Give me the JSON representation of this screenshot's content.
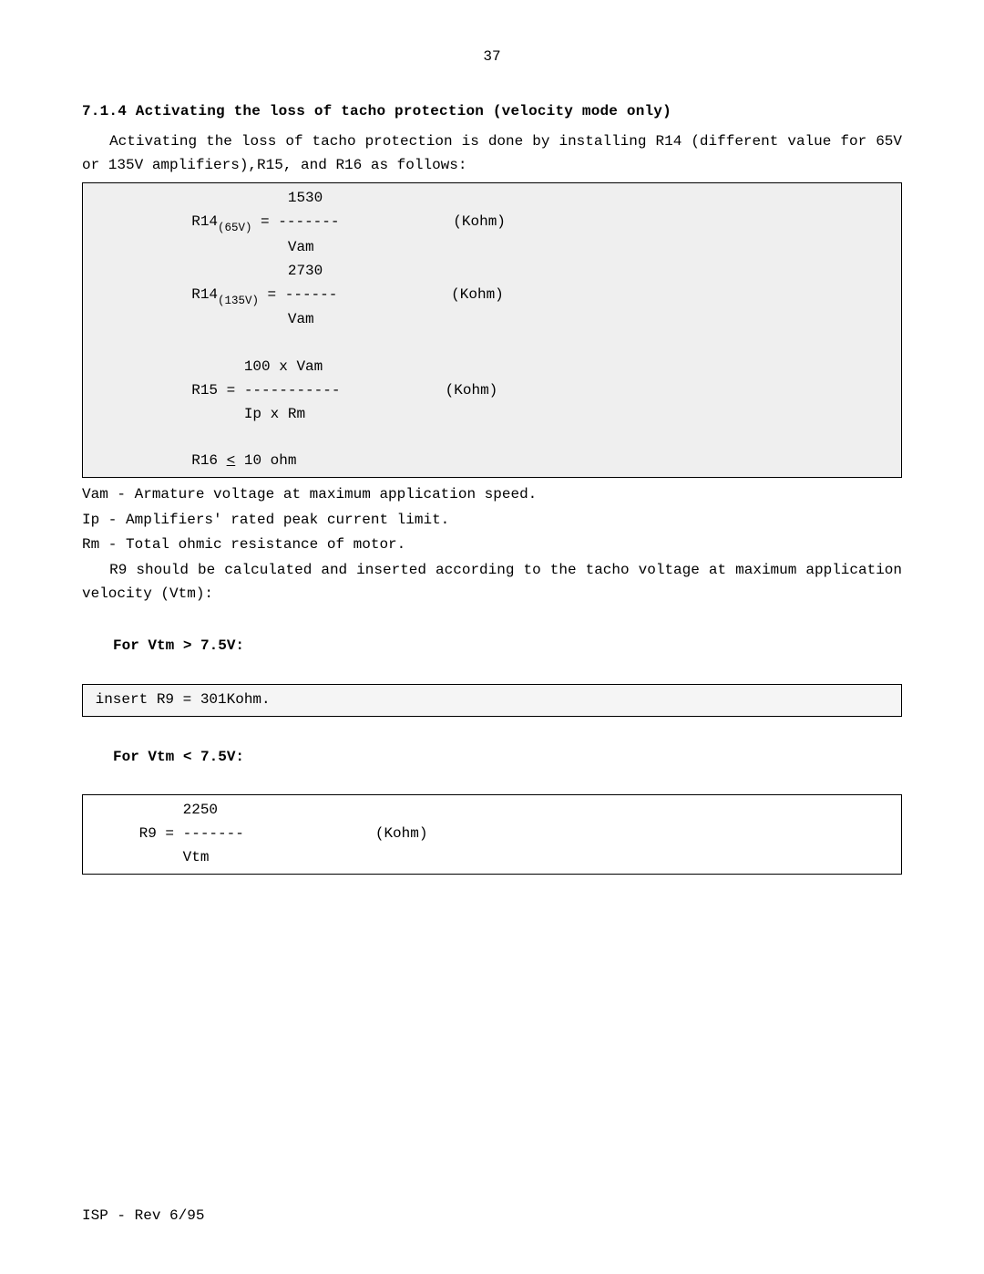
{
  "page_number": "37",
  "heading": "7.1.4  Activating the loss of tacho protection (velocity mode only)",
  "intro_para": "   Activating the loss of tacho protection is done by installing R14 (different value for 65V or 135V amplifiers),R15, and R16 as follows:",
  "formula_box": {
    "r14_65": {
      "num": "                       1530",
      "eq_pre": "            R14",
      "eq_sub": "(65V)",
      "eq_post": " = -------             (Kohm)",
      "den": "                       Vam"
    },
    "r14_135": {
      "num": "                       2730",
      "eq_pre": "            R14",
      "eq_sub": "(135V)",
      "eq_post": " = ------             (Kohm)",
      "den": "                       Vam"
    },
    "r15": {
      "num": "                  100 x Vam",
      "eq": "            R15 = -----------            (Kohm)",
      "den": "                  Ip x Rm"
    },
    "r16_pre": "            R16 ",
    "r16_sym": "<",
    "r16_post": " 10 ohm"
  },
  "defs": {
    "vam": "Vam - Armature voltage at maximum application speed.",
    "ip": "Ip - Amplifiers' rated peak current limit.",
    "rm": "Rm - Total ohmic resistance of motor."
  },
  "r9_para": "   R9 should be calculated and inserted according to the tacho voltage at maximum application velocity (Vtm):",
  "vtm_gt_label": "For Vtm > 7.5V:",
  "r9_box1": " insert R9 = 301Kohm.",
  "vtm_lt_label": "For Vtm < 7.5V:",
  "r9_box2": {
    "num": "           2250",
    "eq": "      R9 = -------               (Kohm)",
    "den": "           Vtm"
  },
  "footer": "ISP - Rev 6/95"
}
